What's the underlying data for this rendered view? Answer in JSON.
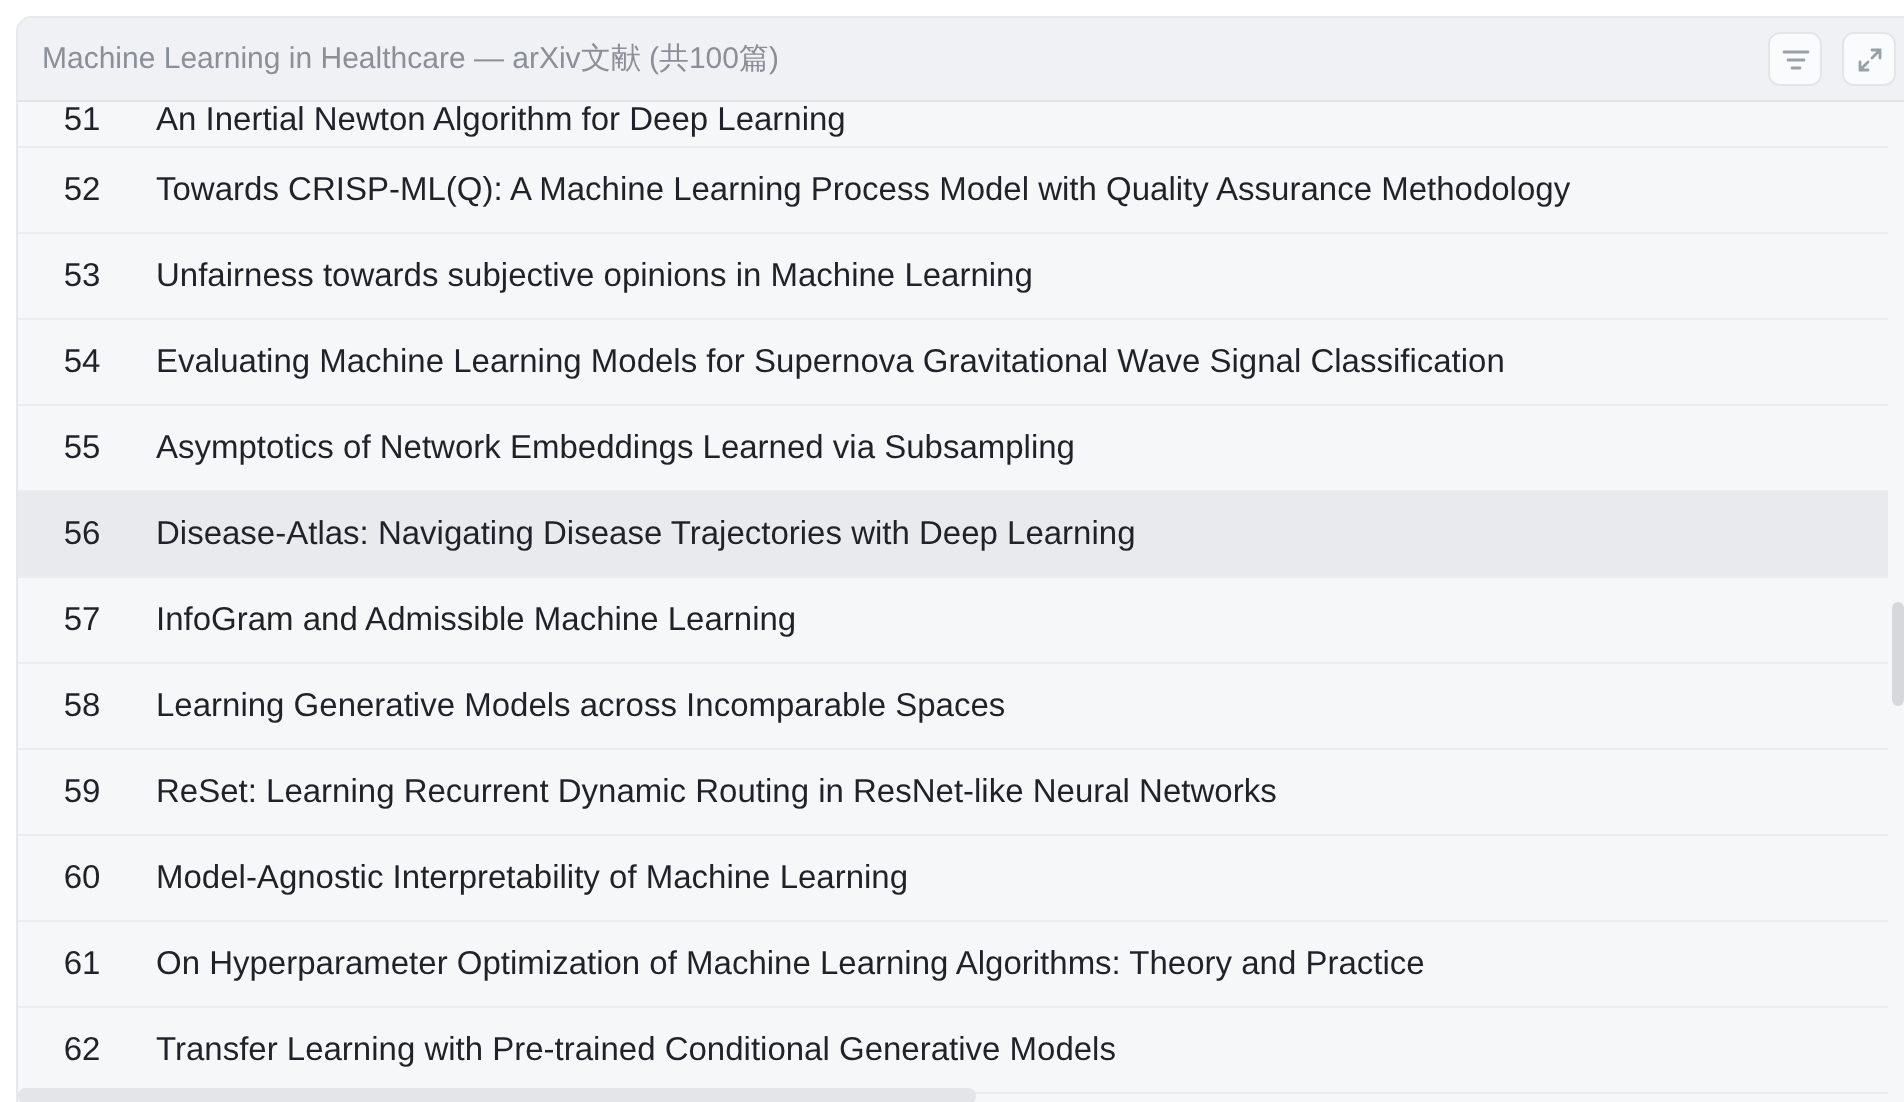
{
  "panel": {
    "title": "Machine Learning in Healthcare — arXiv文献 (共100篇)"
  },
  "rows": [
    {
      "number": "51",
      "title": "An Inertial Newton Algorithm for Deep Learning",
      "selected": false
    },
    {
      "number": "52",
      "title": "Towards CRISP-ML(Q): A Machine Learning Process Model with Quality Assurance Methodology",
      "selected": false
    },
    {
      "number": "53",
      "title": "Unfairness towards subjective opinions in Machine Learning",
      "selected": false
    },
    {
      "number": "54",
      "title": "Evaluating Machine Learning Models for Supernova Gravitational Wave Signal Classification",
      "selected": false
    },
    {
      "number": "55",
      "title": "Asymptotics of Network Embeddings Learned via Subsampling",
      "selected": false
    },
    {
      "number": "56",
      "title": "Disease-Atlas: Navigating Disease Trajectories with Deep Learning",
      "selected": true
    },
    {
      "number": "57",
      "title": "InfoGram and Admissible Machine Learning",
      "selected": false
    },
    {
      "number": "58",
      "title": "Learning Generative Models across Incomparable Spaces",
      "selected": false
    },
    {
      "number": "59",
      "title": "ReSet: Learning Recurrent Dynamic Routing in ResNet-like Neural Networks",
      "selected": false
    },
    {
      "number": "60",
      "title": "Model-Agnostic Interpretability of Machine Learning",
      "selected": false
    },
    {
      "number": "61",
      "title": "On Hyperparameter Optimization of Machine Learning Algorithms: Theory and Practice",
      "selected": false
    },
    {
      "number": "62",
      "title": "Transfer Learning with Pre-trained Conditional Generative Models",
      "selected": false
    }
  ]
}
